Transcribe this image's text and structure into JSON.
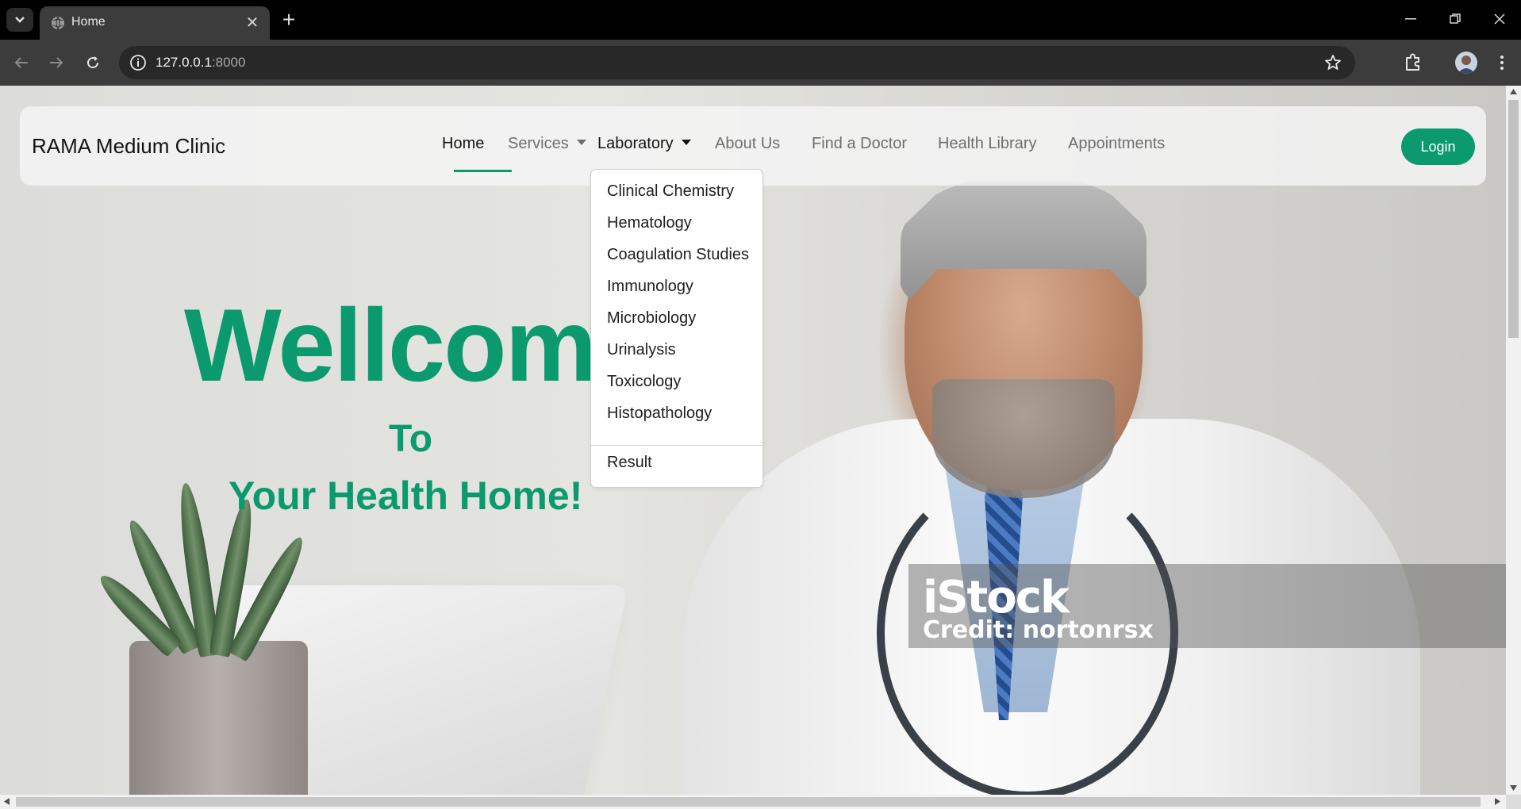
{
  "browser": {
    "tab_title": "Home",
    "url_host": "127.0.0.1",
    "url_port": ":8000"
  },
  "navbar": {
    "brand": "RAMA Medium Clinic",
    "items": [
      {
        "label": "Home",
        "active": true
      },
      {
        "label": "Services",
        "dropdown": true
      },
      {
        "label": "Laboratory",
        "dropdown": true,
        "open": true
      },
      {
        "label": "About Us"
      },
      {
        "label": "Find a Doctor"
      },
      {
        "label": "Health Library"
      },
      {
        "label": "Appointments"
      }
    ],
    "login_label": "Login"
  },
  "laboratory_menu": {
    "items": [
      "Clinical Chemistry",
      "Hematology",
      "Coagulation Studies",
      "Immunology",
      "Microbiology",
      "Urinalysis",
      "Toxicology",
      "Histopathology"
    ],
    "footer_item": "Result"
  },
  "hero": {
    "headline": "Wellcom",
    "line2": "To",
    "line3": "Your Health Home!"
  },
  "watermark": {
    "logo": "iStock",
    "credit": "Credit: nortonrsx"
  },
  "colors": {
    "accent": "#0b9a6d",
    "chrome_dark": "#000000",
    "toolbar": "#3c3c3c"
  }
}
